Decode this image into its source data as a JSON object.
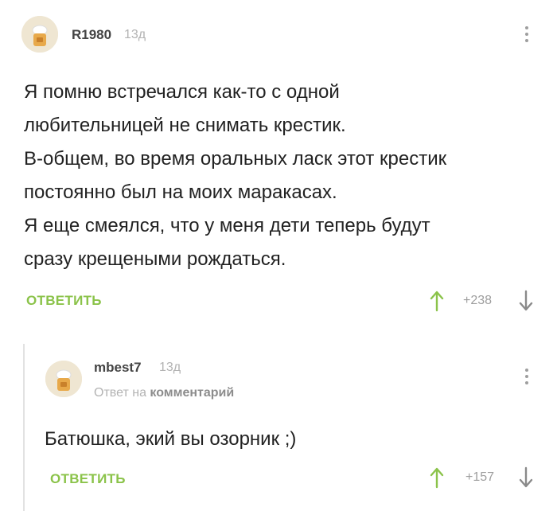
{
  "comments": [
    {
      "username": "R1980",
      "time": "13д",
      "lines": [
        "Я помню встречался как-то с одной",
        "любительницей не снимать крестик.",
        "В-общем, во время оральных ласк этот крестик",
        "постоянно был на моих маракасах.",
        "Я еще смеялся, что у меня дети теперь будут",
        "сразу крещеными рождаться."
      ],
      "reply_label": "ОТВЕТИТЬ",
      "rating": "+238",
      "icons": {
        "up": "arrow-up-icon",
        "down": "arrow-down-icon",
        "menu": "more-vertical-icon"
      }
    },
    {
      "username": "mbest7",
      "time": "13д",
      "reply_prefix": "Ответ на",
      "reply_target": "комментарий",
      "lines": [
        "Батюшка, экий вы озорник ;)"
      ],
      "reply_label": "ОТВЕТИТЬ",
      "rating": "+157",
      "icons": {
        "up": "arrow-up-icon",
        "down": "arrow-down-icon",
        "menu": "more-vertical-icon"
      }
    }
  ],
  "colors": {
    "accent_green": "#8bc34a",
    "muted": "#9e9e9e",
    "text": "#222222"
  }
}
